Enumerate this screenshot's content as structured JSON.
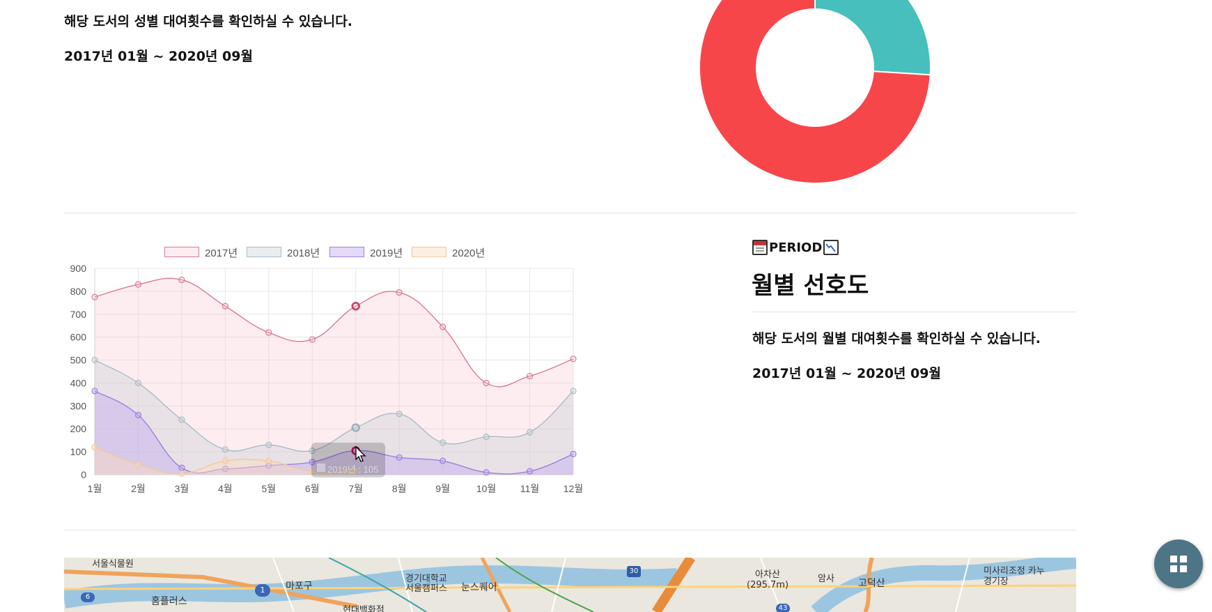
{
  "top_section": {
    "description": "해당 도서의 성별 대여횟수를 확인하실 수 있습니다.",
    "period": "2017년 01월 ~ 2020년 09월"
  },
  "donut_chart": {
    "type": "pie",
    "values": [
      74,
      26
    ],
    "colors": [
      "#f7464a",
      "#46bfbd"
    ]
  },
  "period_section": {
    "tag": "PERIOD",
    "tag_icons": [
      "calendar-icon",
      "chart-down-icon"
    ],
    "title": "월별 선호도",
    "description": "해당 도서의 월별 대여횟수를 확인하실 수 있습니다.",
    "period": "2017년 01월 ~ 2020년 09월"
  },
  "chart_data": {
    "type": "area",
    "categories": [
      "1월",
      "2월",
      "3월",
      "4월",
      "5월",
      "6월",
      "7월",
      "8월",
      "9월",
      "10월",
      "11월",
      "12월"
    ],
    "ylim": [
      0,
      900
    ],
    "yticks": [
      0,
      100,
      200,
      300,
      400,
      500,
      600,
      700,
      800,
      900
    ],
    "grid": true,
    "legend": "top",
    "series": [
      {
        "name": "2017년",
        "values": [
          775,
          830,
          850,
          735,
          620,
          590,
          735,
          795,
          645,
          400,
          430,
          505
        ],
        "color": "#d97a93",
        "fill": "rgba(247,190,205,0.28)"
      },
      {
        "name": "2018년",
        "values": [
          500,
          400,
          240,
          110,
          130,
          105,
          205,
          265,
          140,
          165,
          185,
          365
        ],
        "color": "#a9bcc4",
        "fill": "rgba(200,210,215,0.40)"
      },
      {
        "name": "2019년",
        "values": [
          365,
          260,
          30,
          25,
          40,
          55,
          105,
          75,
          60,
          10,
          15,
          90
        ],
        "color": "#9b7fe0",
        "fill": "rgba(195,170,240,0.45)"
      },
      {
        "name": "2020년",
        "values": [
          120,
          45,
          5,
          60,
          60,
          15,
          20,
          null,
          null,
          null,
          null,
          null
        ],
        "color": "#f3c79b",
        "fill": "rgba(250,220,190,0.45)"
      }
    ],
    "tooltip": {
      "text": "2019년 : 105"
    }
  },
  "map": {
    "labels": [
      "서울식물원",
      "마포구",
      "홈플러스",
      "경기대학교 서울캠퍼스",
      "눈스퀘어",
      "현대백화점",
      "아차산 (295.7m)",
      "암사",
      "고덕산",
      "미사리조정 카누경기장"
    ],
    "road_numbers": [
      "6",
      "1",
      "30",
      "43"
    ]
  },
  "fab": {
    "icon": "grid-icon"
  }
}
